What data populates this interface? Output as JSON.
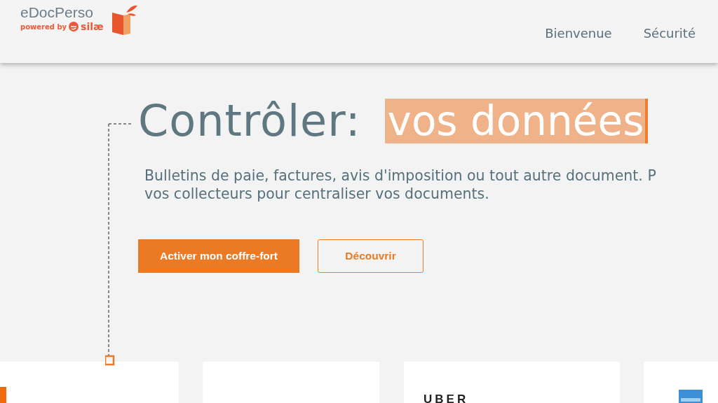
{
  "header": {
    "logo": {
      "name": "eDocPerso",
      "powered_by": "powered by",
      "brand": "silæ"
    },
    "nav": [
      {
        "label": "Bienvenue"
      },
      {
        "label": "Sécurité"
      }
    ]
  },
  "hero": {
    "title": "Contrôler:",
    "highlight": "vos données",
    "description": "Bulletins de paie, factures, avis d'imposition ou tout autre document. P\nvos collecteurs pour centraliser vos documents.",
    "primary_button": "Activer mon coffre-fort",
    "secondary_button": "Découvrir"
  },
  "cards": [
    {
      "kind": "logo-mark"
    },
    {
      "kind": "empty"
    },
    {
      "kind": "text-logo",
      "text": "UBER"
    },
    {
      "kind": "card-logo"
    }
  ]
}
